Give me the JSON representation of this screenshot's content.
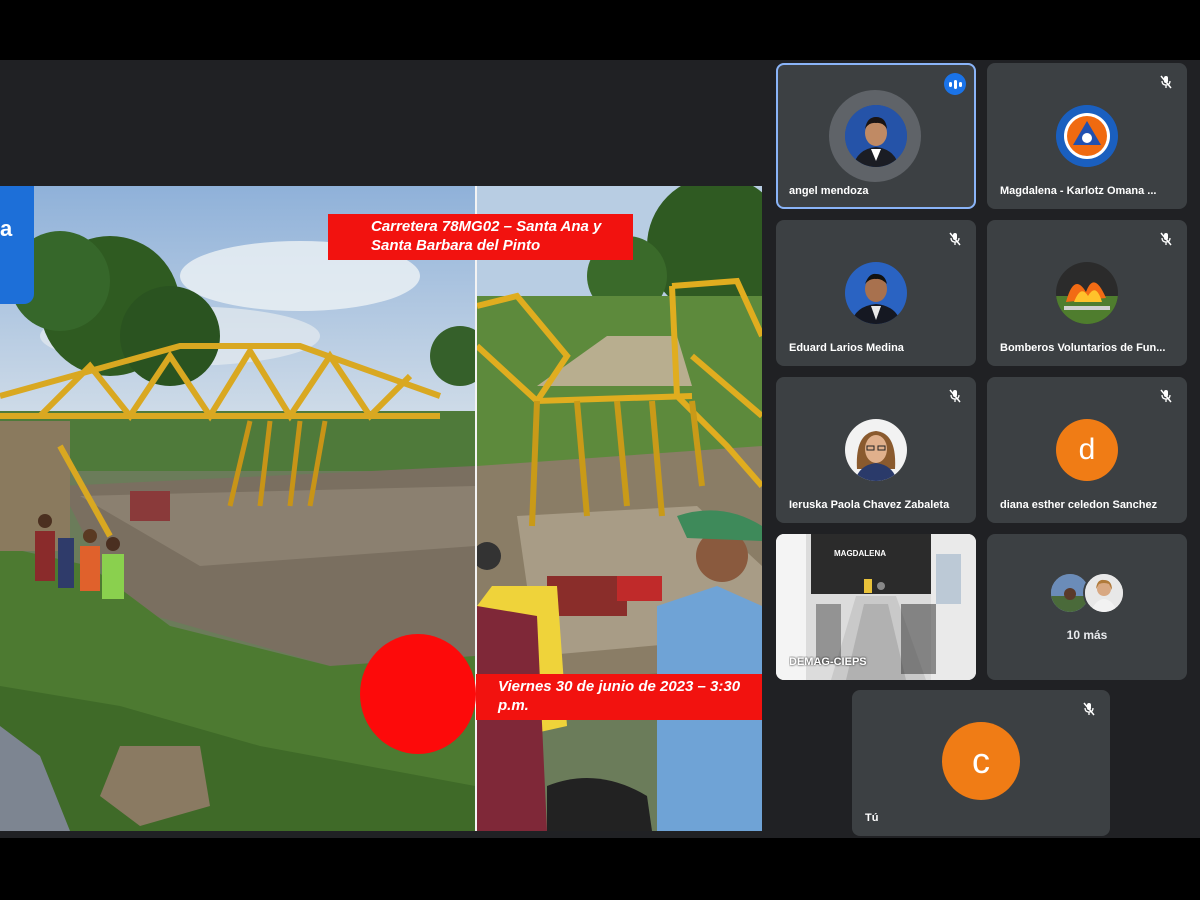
{
  "presentation": {
    "logo_text": "a",
    "caption_top": "Carretera 78MG02 – Santa Ana y Santa Barbara del Pinto",
    "caption_date": "Viernes 30 de junio de 2023 – 3:30 p.m."
  },
  "participants": [
    {
      "name": "angel mendoza",
      "speaking": true
    },
    {
      "name": "Magdalena - Karlotz Omana ...",
      "muted": true
    },
    {
      "name": "Eduard Larios Medina",
      "muted": true
    },
    {
      "name": "Bomberos Voluntarios de Fun...",
      "muted": true
    },
    {
      "name": "Ieruska Paola Chavez Zabaleta",
      "muted": true
    },
    {
      "name": "diana esther celedon Sanchez",
      "muted": true,
      "initial": "d"
    },
    {
      "name": "DEMAG-CIEPS",
      "room_sign": "MAGDALENA"
    },
    {
      "more_label": "10 más"
    },
    {
      "name": "Tú",
      "muted": true,
      "initial": "c"
    }
  ],
  "colors": {
    "tile_bg": "#3c4043",
    "stage_bg": "#202124",
    "active_border": "#8ab4f8",
    "avatar_orange": "#f07c15",
    "caption_red": "#f2120f"
  }
}
